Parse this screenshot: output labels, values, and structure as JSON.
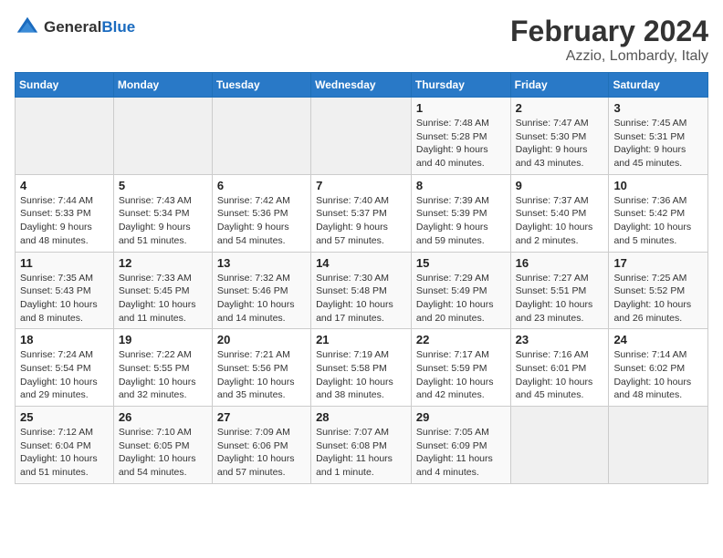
{
  "header": {
    "logo_general": "General",
    "logo_blue": "Blue",
    "title": "February 2024",
    "subtitle": "Azzio, Lombardy, Italy"
  },
  "columns": [
    "Sunday",
    "Monday",
    "Tuesday",
    "Wednesday",
    "Thursday",
    "Friday",
    "Saturday"
  ],
  "weeks": [
    [
      {
        "day": "",
        "content": ""
      },
      {
        "day": "",
        "content": ""
      },
      {
        "day": "",
        "content": ""
      },
      {
        "day": "",
        "content": ""
      },
      {
        "day": "1",
        "content": "Sunrise: 7:48 AM\nSunset: 5:28 PM\nDaylight: 9 hours\nand 40 minutes."
      },
      {
        "day": "2",
        "content": "Sunrise: 7:47 AM\nSunset: 5:30 PM\nDaylight: 9 hours\nand 43 minutes."
      },
      {
        "day": "3",
        "content": "Sunrise: 7:45 AM\nSunset: 5:31 PM\nDaylight: 9 hours\nand 45 minutes."
      }
    ],
    [
      {
        "day": "4",
        "content": "Sunrise: 7:44 AM\nSunset: 5:33 PM\nDaylight: 9 hours\nand 48 minutes."
      },
      {
        "day": "5",
        "content": "Sunrise: 7:43 AM\nSunset: 5:34 PM\nDaylight: 9 hours\nand 51 minutes."
      },
      {
        "day": "6",
        "content": "Sunrise: 7:42 AM\nSunset: 5:36 PM\nDaylight: 9 hours\nand 54 minutes."
      },
      {
        "day": "7",
        "content": "Sunrise: 7:40 AM\nSunset: 5:37 PM\nDaylight: 9 hours\nand 57 minutes."
      },
      {
        "day": "8",
        "content": "Sunrise: 7:39 AM\nSunset: 5:39 PM\nDaylight: 9 hours\nand 59 minutes."
      },
      {
        "day": "9",
        "content": "Sunrise: 7:37 AM\nSunset: 5:40 PM\nDaylight: 10 hours\nand 2 minutes."
      },
      {
        "day": "10",
        "content": "Sunrise: 7:36 AM\nSunset: 5:42 PM\nDaylight: 10 hours\nand 5 minutes."
      }
    ],
    [
      {
        "day": "11",
        "content": "Sunrise: 7:35 AM\nSunset: 5:43 PM\nDaylight: 10 hours\nand 8 minutes."
      },
      {
        "day": "12",
        "content": "Sunrise: 7:33 AM\nSunset: 5:45 PM\nDaylight: 10 hours\nand 11 minutes."
      },
      {
        "day": "13",
        "content": "Sunrise: 7:32 AM\nSunset: 5:46 PM\nDaylight: 10 hours\nand 14 minutes."
      },
      {
        "day": "14",
        "content": "Sunrise: 7:30 AM\nSunset: 5:48 PM\nDaylight: 10 hours\nand 17 minutes."
      },
      {
        "day": "15",
        "content": "Sunrise: 7:29 AM\nSunset: 5:49 PM\nDaylight: 10 hours\nand 20 minutes."
      },
      {
        "day": "16",
        "content": "Sunrise: 7:27 AM\nSunset: 5:51 PM\nDaylight: 10 hours\nand 23 minutes."
      },
      {
        "day": "17",
        "content": "Sunrise: 7:25 AM\nSunset: 5:52 PM\nDaylight: 10 hours\nand 26 minutes."
      }
    ],
    [
      {
        "day": "18",
        "content": "Sunrise: 7:24 AM\nSunset: 5:54 PM\nDaylight: 10 hours\nand 29 minutes."
      },
      {
        "day": "19",
        "content": "Sunrise: 7:22 AM\nSunset: 5:55 PM\nDaylight: 10 hours\nand 32 minutes."
      },
      {
        "day": "20",
        "content": "Sunrise: 7:21 AM\nSunset: 5:56 PM\nDaylight: 10 hours\nand 35 minutes."
      },
      {
        "day": "21",
        "content": "Sunrise: 7:19 AM\nSunset: 5:58 PM\nDaylight: 10 hours\nand 38 minutes."
      },
      {
        "day": "22",
        "content": "Sunrise: 7:17 AM\nSunset: 5:59 PM\nDaylight: 10 hours\nand 42 minutes."
      },
      {
        "day": "23",
        "content": "Sunrise: 7:16 AM\nSunset: 6:01 PM\nDaylight: 10 hours\nand 45 minutes."
      },
      {
        "day": "24",
        "content": "Sunrise: 7:14 AM\nSunset: 6:02 PM\nDaylight: 10 hours\nand 48 minutes."
      }
    ],
    [
      {
        "day": "25",
        "content": "Sunrise: 7:12 AM\nSunset: 6:04 PM\nDaylight: 10 hours\nand 51 minutes."
      },
      {
        "day": "26",
        "content": "Sunrise: 7:10 AM\nSunset: 6:05 PM\nDaylight: 10 hours\nand 54 minutes."
      },
      {
        "day": "27",
        "content": "Sunrise: 7:09 AM\nSunset: 6:06 PM\nDaylight: 10 hours\nand 57 minutes."
      },
      {
        "day": "28",
        "content": "Sunrise: 7:07 AM\nSunset: 6:08 PM\nDaylight: 11 hours\nand 1 minute."
      },
      {
        "day": "29",
        "content": "Sunrise: 7:05 AM\nSunset: 6:09 PM\nDaylight: 11 hours\nand 4 minutes."
      },
      {
        "day": "",
        "content": ""
      },
      {
        "day": "",
        "content": ""
      }
    ]
  ]
}
